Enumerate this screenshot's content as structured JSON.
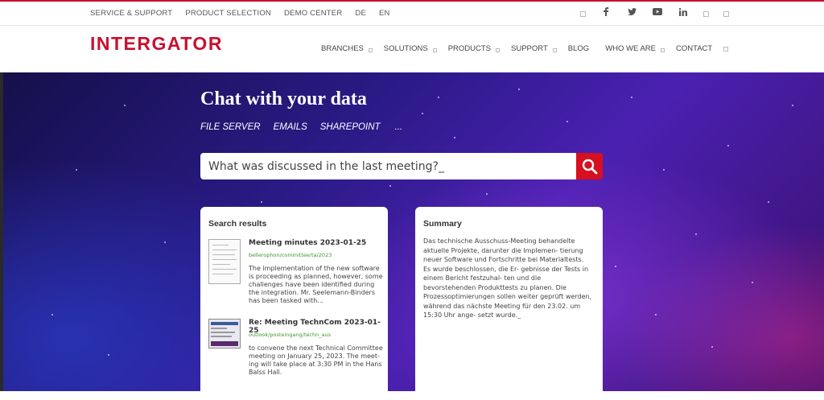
{
  "topbar": {
    "links": [
      "SERVICE & SUPPORT",
      "PRODUCT SELECTION",
      "DEMO CENTER",
      "DE",
      "EN"
    ],
    "social_icons": [
      "square-icon",
      "facebook-icon",
      "twitter-icon",
      "youtube-icon",
      "linkedin-icon",
      "square-icon",
      "square-icon"
    ]
  },
  "brand": {
    "logo": "INTERGATOR",
    "accent_color": "#c8102e"
  },
  "nav": {
    "items": [
      "BRANCHES",
      "SOLUTIONS",
      "PRODUCTS",
      "SUPPORT",
      "BLOG",
      "WHO WE ARE",
      "CONTACT"
    ]
  },
  "hero": {
    "title": "Chat with your data",
    "sources": [
      "FILE SERVER",
      "EMAILS",
      "SHAREPOINT",
      "..."
    ],
    "search_value": "What was discussed in the last meeting?_",
    "search_button_color": "#d6101f"
  },
  "results": {
    "heading": "Search results",
    "items": [
      {
        "title": "Meeting minutes 2023-01-25",
        "path": "bellerophon/committee/ta/2023",
        "snippet": "The implementation of the new software is proceeding as planned, however, some challenges have been identified during the integration. Mr. Seelemann-Binders has been tasked with..."
      },
      {
        "title": "Re: Meeting TechnCom 2023-01-25",
        "path": "outlook/posteingang/techn_aus",
        "snippet": "to convene the next Technical Committee meeting on January 25, 2023. The meet- ing will take place at 3:30 PM in the Hans Balss Hall."
      }
    ]
  },
  "summary": {
    "heading": "Summary",
    "text": "Das technische Ausschuss-Meeting behandelte aktuelle Projekte, darunter die Implemen- tierung neuer Software und Fortschritte bei Materialtests. Es wurde beschlossen, die Er- gebnisse der Tests in einem Bericht festzuhal- ten und die bevorstehenden Produkttests zu planen. Die Prozessoptimierungen sollen weiter geprüft werden, während das nächste Meeting für den 23.02. um 15:30 Uhr ange- setzt wurde._"
  }
}
